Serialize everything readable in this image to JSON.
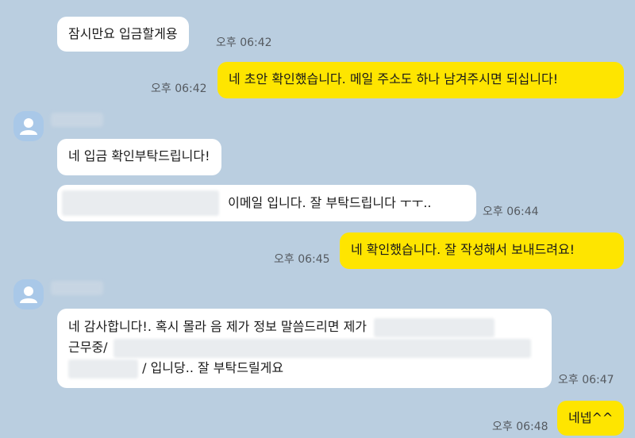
{
  "messages": [
    {
      "text": "잠시만요 입금할게용",
      "time": "오후 06:42"
    },
    {
      "text": "네 초안 확인했습니다. 메일 주소도 하나 남겨주시면 되십니다!",
      "time": "오후 06:42"
    },
    {
      "text": "네 입금 확인부탁드립니다!"
    },
    {
      "text": "이메일 입니다. 잘 부탁드립니다 ㅜㅜ..",
      "time": "오후 06:44"
    },
    {
      "text": "네 확인했습니다. 잘 작성해서 보내드려요!",
      "time": "오후 06:45"
    },
    {
      "line1": "네 감사합니다!. 혹시 몰라 음 제가 정보 말씀드리면 제가",
      "line2": "근무중/",
      "line3": "/ 입니당.. 잘 부탁드릴게요",
      "time": "오후 06:47"
    },
    {
      "text": "네넵^^",
      "time": "오후 06:48"
    }
  ]
}
